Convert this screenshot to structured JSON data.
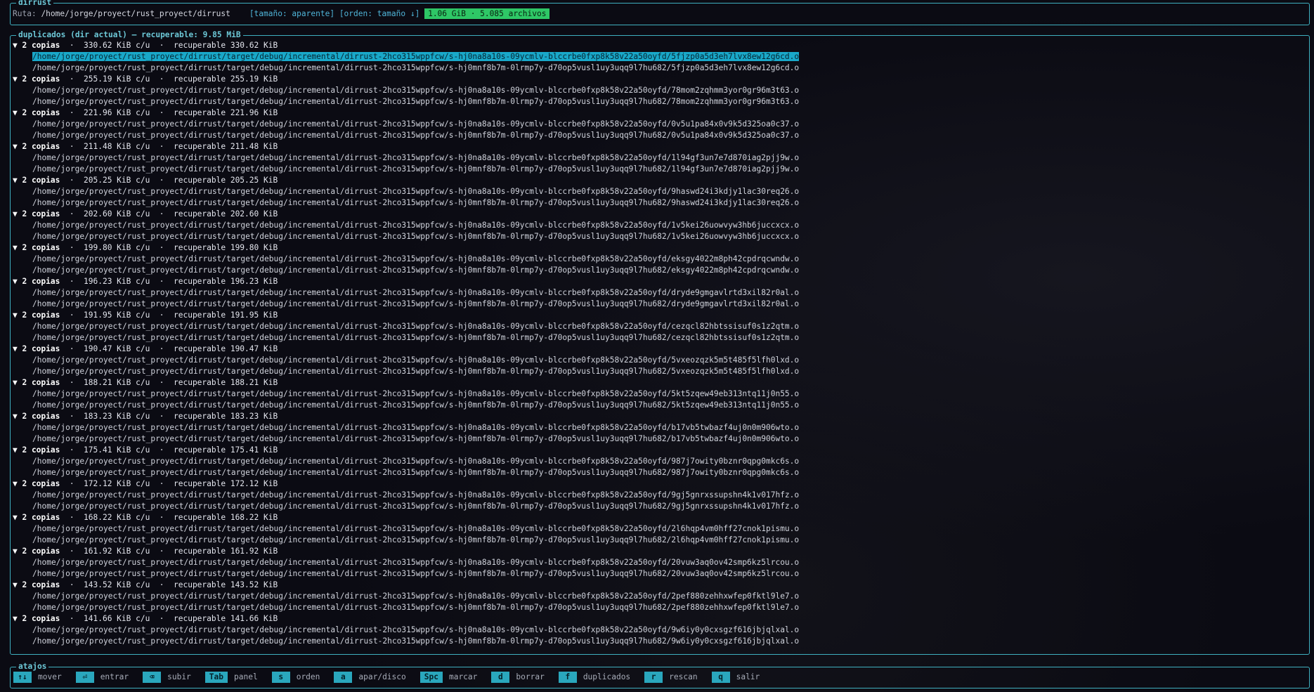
{
  "header": {
    "title": "dirrust",
    "path_label": "Ruta:",
    "path": "/home/jorge/proyect/rust_proyect/dirrust",
    "size_mode": "[tamaño: aparente]",
    "sort_mode": "[orden: tamaño ↓]",
    "summary": "1.06 GiB · 5.085 archivos"
  },
  "duplicates": {
    "title": "duplicados (dir actual) — recuperable: 9.85 MiB",
    "groups": [
      {
        "copies": "▼ 2 copias",
        "detail": "  ·  330.62 KiB c/u  ·  recuperable 330.62 KiB",
        "files": [
          "/home/jorge/proyect/rust_proyect/dirrust/target/debug/incremental/dirrust-2hco315wppfcw/s-hj0na8a10s-09ycmlv-blccrbe0fxp8k58v22a50oyfd/5fjzp0a5d3eh7lvx8ew12g6cd.o",
          "/home/jorge/proyect/rust_proyect/dirrust/target/debug/incremental/dirrust-2hco315wppfcw/s-hj0mnf8b7m-0lrmp7y-d70op5vusl1uy3uqq9l7hu682/5fjzp0a5d3eh7lvx8ew12g6cd.o"
        ]
      },
      {
        "copies": "▼ 2 copias",
        "detail": "  ·  255.19 KiB c/u  ·  recuperable 255.19 KiB",
        "files": [
          "/home/jorge/proyect/rust_proyect/dirrust/target/debug/incremental/dirrust-2hco315wppfcw/s-hj0na8a10s-09ycmlv-blccrbe0fxp8k58v22a50oyfd/78mom2zqhmm3yor0gr96m3t63.o",
          "/home/jorge/proyect/rust_proyect/dirrust/target/debug/incremental/dirrust-2hco315wppfcw/s-hj0mnf8b7m-0lrmp7y-d70op5vusl1uy3uqq9l7hu682/78mom2zqhmm3yor0gr96m3t63.o"
        ]
      },
      {
        "copies": "▼ 2 copias",
        "detail": "  ·  221.96 KiB c/u  ·  recuperable 221.96 KiB",
        "files": [
          "/home/jorge/proyect/rust_proyect/dirrust/target/debug/incremental/dirrust-2hco315wppfcw/s-hj0na8a10s-09ycmlv-blccrbe0fxp8k58v22a50oyfd/0v5u1pa84x0v9k5d325oa0c37.o",
          "/home/jorge/proyect/rust_proyect/dirrust/target/debug/incremental/dirrust-2hco315wppfcw/s-hj0mnf8b7m-0lrmp7y-d70op5vusl1uy3uqq9l7hu682/0v5u1pa84x0v9k5d325oa0c37.o"
        ]
      },
      {
        "copies": "▼ 2 copias",
        "detail": "  ·  211.48 KiB c/u  ·  recuperable 211.48 KiB",
        "files": [
          "/home/jorge/proyect/rust_proyect/dirrust/target/debug/incremental/dirrust-2hco315wppfcw/s-hj0na8a10s-09ycmlv-blccrbe0fxp8k58v22a50oyfd/1l94gf3un7e7d870iag2pjj9w.o",
          "/home/jorge/proyect/rust_proyect/dirrust/target/debug/incremental/dirrust-2hco315wppfcw/s-hj0mnf8b7m-0lrmp7y-d70op5vusl1uy3uqq9l7hu682/1l94gf3un7e7d870iag2pjj9w.o"
        ]
      },
      {
        "copies": "▼ 2 copias",
        "detail": "  ·  205.25 KiB c/u  ·  recuperable 205.25 KiB",
        "files": [
          "/home/jorge/proyect/rust_proyect/dirrust/target/debug/incremental/dirrust-2hco315wppfcw/s-hj0na8a10s-09ycmlv-blccrbe0fxp8k58v22a50oyfd/9haswd24i3kdjy1lac30req26.o",
          "/home/jorge/proyect/rust_proyect/dirrust/target/debug/incremental/dirrust-2hco315wppfcw/s-hj0mnf8b7m-0lrmp7y-d70op5vusl1uy3uqq9l7hu682/9haswd24i3kdjy1lac30req26.o"
        ]
      },
      {
        "copies": "▼ 2 copias",
        "detail": "  ·  202.60 KiB c/u  ·  recuperable 202.60 KiB",
        "files": [
          "/home/jorge/proyect/rust_proyect/dirrust/target/debug/incremental/dirrust-2hco315wppfcw/s-hj0na8a10s-09ycmlv-blccrbe0fxp8k58v22a50oyfd/1v5kei26uowvyw3hb6juccxcx.o",
          "/home/jorge/proyect/rust_proyect/dirrust/target/debug/incremental/dirrust-2hco315wppfcw/s-hj0mnf8b7m-0lrmp7y-d70op5vusl1uy3uqq9l7hu682/1v5kei26uowvyw3hb6juccxcx.o"
        ]
      },
      {
        "copies": "▼ 2 copias",
        "detail": "  ·  199.80 KiB c/u  ·  recuperable 199.80 KiB",
        "files": [
          "/home/jorge/proyect/rust_proyect/dirrust/target/debug/incremental/dirrust-2hco315wppfcw/s-hj0na8a10s-09ycmlv-blccrbe0fxp8k58v22a50oyfd/eksgy4022m8ph42cpdrqcwndw.o",
          "/home/jorge/proyect/rust_proyect/dirrust/target/debug/incremental/dirrust-2hco315wppfcw/s-hj0mnf8b7m-0lrmp7y-d70op5vusl1uy3uqq9l7hu682/eksgy4022m8ph42cpdrqcwndw.o"
        ]
      },
      {
        "copies": "▼ 2 copias",
        "detail": "  ·  196.23 KiB c/u  ·  recuperable 196.23 KiB",
        "files": [
          "/home/jorge/proyect/rust_proyect/dirrust/target/debug/incremental/dirrust-2hco315wppfcw/s-hj0na8a10s-09ycmlv-blccrbe0fxp8k58v22a50oyfd/dryde9gmgavlrtd3xil82r0al.o",
          "/home/jorge/proyect/rust_proyect/dirrust/target/debug/incremental/dirrust-2hco315wppfcw/s-hj0mnf8b7m-0lrmp7y-d70op5vusl1uy3uqq9l7hu682/dryde9gmgavlrtd3xil82r0al.o"
        ]
      },
      {
        "copies": "▼ 2 copias",
        "detail": "  ·  191.95 KiB c/u  ·  recuperable 191.95 KiB",
        "files": [
          "/home/jorge/proyect/rust_proyect/dirrust/target/debug/incremental/dirrust-2hco315wppfcw/s-hj0na8a10s-09ycmlv-blccrbe0fxp8k58v22a50oyfd/cezqcl82hbtssisuf0s1z2qtm.o",
          "/home/jorge/proyect/rust_proyect/dirrust/target/debug/incremental/dirrust-2hco315wppfcw/s-hj0mnf8b7m-0lrmp7y-d70op5vusl1uy3uqq9l7hu682/cezqcl82hbtssisuf0s1z2qtm.o"
        ]
      },
      {
        "copies": "▼ 2 copias",
        "detail": "  ·  190.47 KiB c/u  ·  recuperable 190.47 KiB",
        "files": [
          "/home/jorge/proyect/rust_proyect/dirrust/target/debug/incremental/dirrust-2hco315wppfcw/s-hj0na8a10s-09ycmlv-blccrbe0fxp8k58v22a50oyfd/5vxeozqzk5m5t485f5lfh0lxd.o",
          "/home/jorge/proyect/rust_proyect/dirrust/target/debug/incremental/dirrust-2hco315wppfcw/s-hj0mnf8b7m-0lrmp7y-d70op5vusl1uy3uqq9l7hu682/5vxeozqzk5m5t485f5lfh0lxd.o"
        ]
      },
      {
        "copies": "▼ 2 copias",
        "detail": "  ·  188.21 KiB c/u  ·  recuperable 188.21 KiB",
        "files": [
          "/home/jorge/proyect/rust_proyect/dirrust/target/debug/incremental/dirrust-2hco315wppfcw/s-hj0na8a10s-09ycmlv-blccrbe0fxp8k58v22a50oyfd/5kt5zqew49eb313ntq11j0n55.o",
          "/home/jorge/proyect/rust_proyect/dirrust/target/debug/incremental/dirrust-2hco315wppfcw/s-hj0mnf8b7m-0lrmp7y-d70op5vusl1uy3uqq9l7hu682/5kt5zqew49eb313ntq11j0n55.o"
        ]
      },
      {
        "copies": "▼ 2 copias",
        "detail": "  ·  183.23 KiB c/u  ·  recuperable 183.23 KiB",
        "files": [
          "/home/jorge/proyect/rust_proyect/dirrust/target/debug/incremental/dirrust-2hco315wppfcw/s-hj0na8a10s-09ycmlv-blccrbe0fxp8k58v22a50oyfd/b17vb5twbazf4uj0n0m906wto.o",
          "/home/jorge/proyect/rust_proyect/dirrust/target/debug/incremental/dirrust-2hco315wppfcw/s-hj0mnf8b7m-0lrmp7y-d70op5vusl1uy3uqq9l7hu682/b17vb5twbazf4uj0n0m906wto.o"
        ]
      },
      {
        "copies": "▼ 2 copias",
        "detail": "  ·  175.41 KiB c/u  ·  recuperable 175.41 KiB",
        "files": [
          "/home/jorge/proyect/rust_proyect/dirrust/target/debug/incremental/dirrust-2hco315wppfcw/s-hj0na8a10s-09ycmlv-blccrbe0fxp8k58v22a50oyfd/987j7owity0bznr0qpg0mkc6s.o",
          "/home/jorge/proyect/rust_proyect/dirrust/target/debug/incremental/dirrust-2hco315wppfcw/s-hj0mnf8b7m-0lrmp7y-d70op5vusl1uy3uqq9l7hu682/987j7owity0bznr0qpg0mkc6s.o"
        ]
      },
      {
        "copies": "▼ 2 copias",
        "detail": "  ·  172.12 KiB c/u  ·  recuperable 172.12 KiB",
        "files": [
          "/home/jorge/proyect/rust_proyect/dirrust/target/debug/incremental/dirrust-2hco315wppfcw/s-hj0na8a10s-09ycmlv-blccrbe0fxp8k58v22a50oyfd/9gj5gnrxssupshn4k1v017hfz.o",
          "/home/jorge/proyect/rust_proyect/dirrust/target/debug/incremental/dirrust-2hco315wppfcw/s-hj0mnf8b7m-0lrmp7y-d70op5vusl1uy3uqq9l7hu682/9gj5gnrxssupshn4k1v017hfz.o"
        ]
      },
      {
        "copies": "▼ 2 copias",
        "detail": "  ·  168.22 KiB c/u  ·  recuperable 168.22 KiB",
        "files": [
          "/home/jorge/proyect/rust_proyect/dirrust/target/debug/incremental/dirrust-2hco315wppfcw/s-hj0na8a10s-09ycmlv-blccrbe0fxp8k58v22a50oyfd/2l6hqp4vm0hff27cnok1pismu.o",
          "/home/jorge/proyect/rust_proyect/dirrust/target/debug/incremental/dirrust-2hco315wppfcw/s-hj0mnf8b7m-0lrmp7y-d70op5vusl1uy3uqq9l7hu682/2l6hqp4vm0hff27cnok1pismu.o"
        ]
      },
      {
        "copies": "▼ 2 copias",
        "detail": "  ·  161.92 KiB c/u  ·  recuperable 161.92 KiB",
        "files": [
          "/home/jorge/proyect/rust_proyect/dirrust/target/debug/incremental/dirrust-2hco315wppfcw/s-hj0na8a10s-09ycmlv-blccrbe0fxp8k58v22a50oyfd/20vuw3aq0ov42smp6kz5lrcou.o",
          "/home/jorge/proyect/rust_proyect/dirrust/target/debug/incremental/dirrust-2hco315wppfcw/s-hj0mnf8b7m-0lrmp7y-d70op5vusl1uy3uqq9l7hu682/20vuw3aq0ov42smp6kz5lrcou.o"
        ]
      },
      {
        "copies": "▼ 2 copias",
        "detail": "  ·  143.52 KiB c/u  ·  recuperable 143.52 KiB",
        "files": [
          "/home/jorge/proyect/rust_proyect/dirrust/target/debug/incremental/dirrust-2hco315wppfcw/s-hj0na8a10s-09ycmlv-blccrbe0fxp8k58v22a50oyfd/2pef880zehhxwfep0fktl9le7.o",
          "/home/jorge/proyect/rust_proyect/dirrust/target/debug/incremental/dirrust-2hco315wppfcw/s-hj0mnf8b7m-0lrmp7y-d70op5vusl1uy3uqq9l7hu682/2pef880zehhxwfep0fktl9le7.o"
        ]
      },
      {
        "copies": "▼ 2 copias",
        "detail": "  ·  141.66 KiB c/u  ·  recuperable 141.66 KiB",
        "files": [
          "/home/jorge/proyect/rust_proyect/dirrust/target/debug/incremental/dirrust-2hco315wppfcw/s-hj0na8a10s-09ycmlv-blccrbe0fxp8k58v22a50oyfd/9w6iy0y0cxsgzf616jbjqlxal.o",
          "/home/jorge/proyect/rust_proyect/dirrust/target/debug/incremental/dirrust-2hco315wppfcw/s-hj0mnf8b7m-0lrmp7y-d70op5vusl1uy3uqq9l7hu682/9w6iy0y0cxsgzf616jbjqlxal.o"
        ]
      }
    ]
  },
  "shortcuts": {
    "title": "atajos",
    "items": [
      {
        "key": "↑↓",
        "label": "mover"
      },
      {
        "key": "⏎",
        "label": "entrar"
      },
      {
        "key": "⌫",
        "label": "subir"
      },
      {
        "key": "Tab",
        "label": "panel"
      },
      {
        "key": "s",
        "label": "orden"
      },
      {
        "key": "a",
        "label": "apar/disco"
      },
      {
        "key": "Spc",
        "label": "marcar"
      },
      {
        "key": "d",
        "label": "borrar"
      },
      {
        "key": "f",
        "label": "duplicados"
      },
      {
        "key": "r",
        "label": "rescan"
      },
      {
        "key": "q",
        "label": "salir"
      }
    ]
  }
}
